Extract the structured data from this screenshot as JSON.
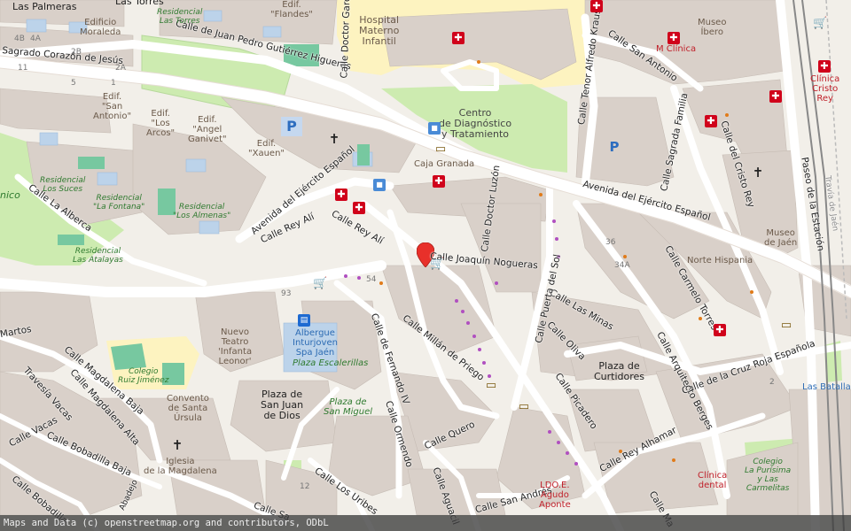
{
  "map": {
    "colors": {
      "background": "#f2efe9",
      "building": "#d9d0c9",
      "park": "#cdebb0",
      "hospital_area": "#fdf3c0",
      "road_major": "#ffffff",
      "railway": "#888888",
      "residential_blue": "#bcd3ea",
      "marker": "#e8302a"
    },
    "streets": [
      {
        "text": "Calle de Juan Pedro Gutiérrez Higueras"
      },
      {
        "text": "Sagrado Corazón de Jesús"
      },
      {
        "text": "Avenida del Ejército Español"
      },
      {
        "text": "Avenida del Ejército Español"
      },
      {
        "text": "Calle Rey Alí"
      },
      {
        "text": "Calle Rey Alí"
      },
      {
        "text": "Calle Joaquín Nogueras"
      },
      {
        "text": "Calle Doctor Luzón"
      },
      {
        "text": "Calle Doctor García"
      },
      {
        "text": "Calle Tenor Alfredo Kraus"
      },
      {
        "text": "Calle San Antonio"
      },
      {
        "text": "Calle Sagrada Familia"
      },
      {
        "text": "Calle del Cristo Rey"
      },
      {
        "text": "Paseo de la Estación"
      },
      {
        "text": "Travía de Jaén"
      },
      {
        "text": "Calle Carmelo Torres"
      },
      {
        "text": "Calle de la Cruz Roja Española"
      },
      {
        "text": "Calle Arquitecto Berges"
      },
      {
        "text": "Calle Las Minas"
      },
      {
        "text": "Calle Puerta del Sol"
      },
      {
        "text": "Calle Oliva"
      },
      {
        "text": "Calle Picadero"
      },
      {
        "text": "Calle Rey Alhamar"
      },
      {
        "text": "Calle Millán de Priego"
      },
      {
        "text": "Calle de Fernando IV"
      },
      {
        "text": "Calle Ormendo"
      },
      {
        "text": "Calle Quero"
      },
      {
        "text": "Calle San Andrés"
      },
      {
        "text": "Calle Los Uribes"
      },
      {
        "text": "Calle Aguacil"
      },
      {
        "text": "Calle La Alberca"
      },
      {
        "text": "Calle Magdalena Baja"
      },
      {
        "text": "Calle Magdalena Alta"
      },
      {
        "text": "Travesía Vacas"
      },
      {
        "text": "Calle Vacas"
      },
      {
        "text": "Calle Bobadilla Baja"
      },
      {
        "text": "Calle Bobadilla"
      },
      {
        "text": "Martos"
      },
      {
        "text": "Calle Ma"
      },
      {
        "text": "Las Palmeras"
      },
      {
        "text": "Las Torres"
      },
      {
        "text": "Calle Sa"
      },
      {
        "text": "Abadejo"
      }
    ],
    "labels": [
      {
        "text": "Hospital\nMaterno\nInfantil"
      },
      {
        "text": "Centro\nde Diagnóstico\ny Tratamiento"
      },
      {
        "text": "Caja Granada"
      },
      {
        "text": "Edificio\nMoraleda"
      },
      {
        "text": "Edif.\n\"Flandes\""
      },
      {
        "text": "Edif.\n\"San\nAntonio\""
      },
      {
        "text": "Edif.\n\"Los\nArcos\""
      },
      {
        "text": "Edif.\n\"Angel\nGanivet\""
      },
      {
        "text": "Edif.\n\"Xauen\""
      },
      {
        "text": "Residencial\nLas Torres"
      },
      {
        "text": "Residencial\nLos Suces"
      },
      {
        "text": "Residencial\n\"La Fontana\""
      },
      {
        "text": "Residencial\n\"Los Almenas\""
      },
      {
        "text": "Residencial\nLas Atalayas"
      },
      {
        "text": "Museo\nÍbero"
      },
      {
        "text": "M Clínica"
      },
      {
        "text": "Clínica\nCristo\nRey"
      },
      {
        "text": "Museo\nde Jaén"
      },
      {
        "text": "Norte Hispania"
      },
      {
        "text": "Nuevo\nTeatro\n'Infanta\nLeonor'"
      },
      {
        "text": "Albergue\nInturjoven\nSpa Jaén"
      },
      {
        "text": "Plaza Escalerillas"
      },
      {
        "text": "Plaza de\nSan Juan\nde Dios"
      },
      {
        "text": "Plaza de\nSan Miguel"
      },
      {
        "text": "Convento\nde Santa\nÚrsula"
      },
      {
        "text": "Colegio\nRuiz Jiménez"
      },
      {
        "text": "Iglesia\nde la Magdalena"
      },
      {
        "text": "Plaza de\nCurtidores"
      },
      {
        "text": "Clínica\ndental"
      },
      {
        "text": "Colegio\nLa Purísima\ny Las\nCarmelitas"
      },
      {
        "text": "LDO.E.\nAgudo\nAponte"
      },
      {
        "text": "Las Batallas"
      },
      {
        "text": "nico"
      }
    ],
    "house_numbers": [
      "4B",
      "4A",
      "2B",
      "2A",
      "11",
      "5",
      "1",
      "93",
      "54",
      "36",
      "34A",
      "2",
      "12"
    ],
    "icons": [
      {
        "name": "health-icon"
      },
      {
        "name": "health-icon"
      },
      {
        "name": "health-icon"
      },
      {
        "name": "health-icon"
      },
      {
        "name": "health-icon"
      },
      {
        "name": "health-icon"
      },
      {
        "name": "health-icon"
      },
      {
        "name": "health-icon"
      },
      {
        "name": "health-icon"
      },
      {
        "name": "health-icon"
      },
      {
        "name": "church-icon"
      },
      {
        "name": "church-icon"
      },
      {
        "name": "church-icon"
      },
      {
        "name": "bank-icon"
      },
      {
        "name": "bank-icon"
      },
      {
        "name": "bank-icon"
      },
      {
        "name": "bank-icon"
      },
      {
        "name": "shop-icon"
      },
      {
        "name": "shop-icon"
      },
      {
        "name": "shop-icon"
      },
      {
        "name": "bus-stop-icon"
      },
      {
        "name": "bus-stop-icon"
      },
      {
        "name": "hotel-icon"
      }
    ],
    "parking_label": "P",
    "attribution": "Maps and Data (c) openstreetmap.org and contributors, ODbL"
  }
}
